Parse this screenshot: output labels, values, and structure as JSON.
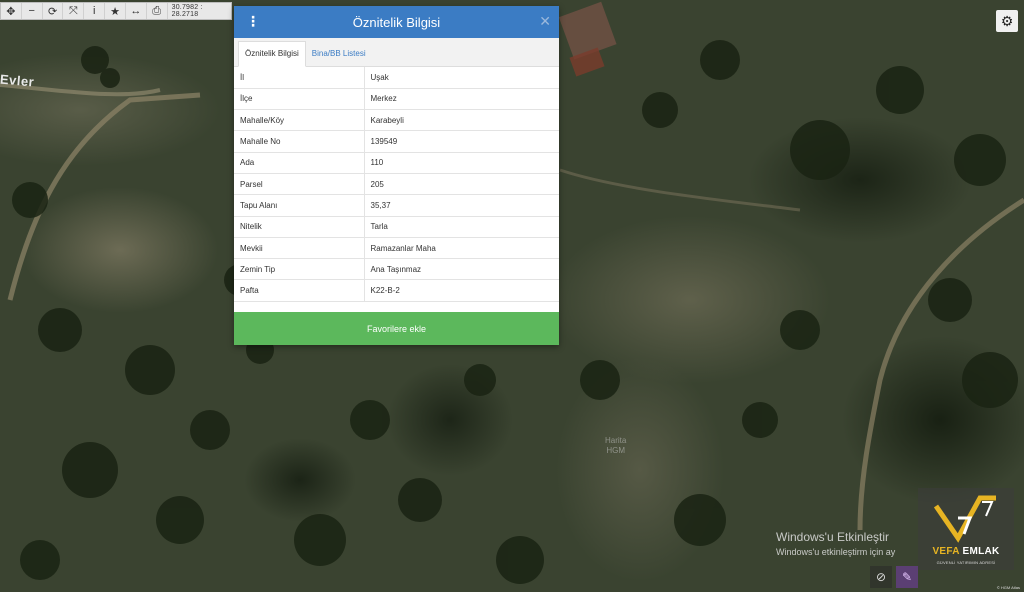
{
  "toolbar": {
    "buttons": [
      {
        "name": "pan-icon",
        "glyph": "✥"
      },
      {
        "name": "zoom-out-icon",
        "glyph": "−"
      },
      {
        "name": "refresh-icon",
        "glyph": "⟳"
      },
      {
        "name": "full-extent-icon",
        "glyph": "⤧"
      },
      {
        "name": "info-icon",
        "glyph": "i"
      },
      {
        "name": "favorite-icon",
        "glyph": "★"
      },
      {
        "name": "measure-icon",
        "glyph": "↔"
      },
      {
        "name": "print-icon",
        "glyph": "⎙"
      }
    ],
    "coordinates": "30.7982 : 28.2718"
  },
  "map": {
    "label_evler": "Evler",
    "watermark_hgm": [
      "Harita",
      "HGM"
    ]
  },
  "dialog": {
    "title": "Öznitelik Bilgisi",
    "menu_icon": "⋮",
    "close_icon": "✕",
    "tabs": [
      {
        "label": "Öznitelik Bilgisi",
        "active": true
      },
      {
        "label": "Bina/BB Listesi",
        "active": false
      }
    ],
    "rows": [
      {
        "key": "İl",
        "value": "Uşak"
      },
      {
        "key": "İlçe",
        "value": "Merkez"
      },
      {
        "key": "Mahalle/Köy",
        "value": "Karabeyli"
      },
      {
        "key": "Mahalle No",
        "value": "139549"
      },
      {
        "key": "Ada",
        "value": "110"
      },
      {
        "key": "Parsel",
        "value": "205"
      },
      {
        "key": "Tapu Alanı",
        "value": "35,37"
      },
      {
        "key": "Nitelik",
        "value": "Tarla"
      },
      {
        "key": "Mevkii",
        "value": "Ramazanlar Maha"
      },
      {
        "key": "Zemin Tip",
        "value": "Ana Taşınmaz"
      },
      {
        "key": "Pafta",
        "value": "K22-B-2"
      }
    ],
    "favorite_button": "Favorilere ekle"
  },
  "windows_watermark": {
    "line1": "Windows'u Etkinleştir",
    "line2": "Windows'u etkinleştirm  için ay"
  },
  "logo": {
    "brand_part1": "VEFA",
    "brand_part2": "EMLAK",
    "tagline": "GÜVENLİ YATIRIMIN ADRESİ",
    "brand_color": "#e7b423"
  },
  "map_controls": {
    "settings_icon": "⚙",
    "layer_icon": "⊘",
    "draw_icon": "✎"
  },
  "attribution": "© HGM Atlas",
  "colors": {
    "header": "#3b7cc4",
    "favorite_button": "#5cb85c"
  }
}
